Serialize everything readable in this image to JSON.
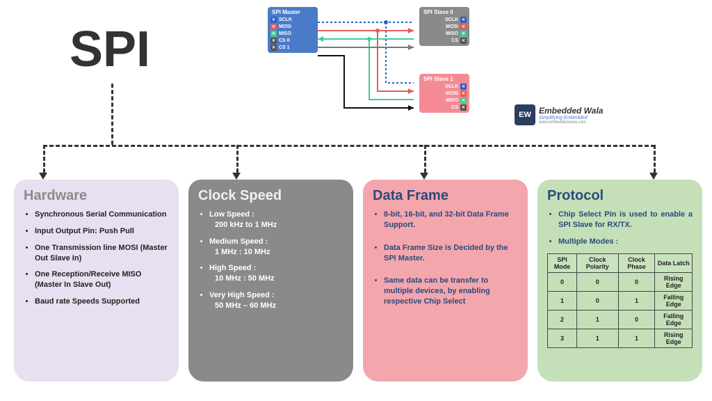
{
  "title": "SPI",
  "diagram": {
    "master": {
      "title": "SPI Master",
      "pins": [
        "SCLK",
        "MOSI",
        "MISO",
        "CS 0",
        "CS 1"
      ]
    },
    "slave0": {
      "title": "SPI Slave 0",
      "pins": [
        "SCLK",
        "MOSI",
        "MISO",
        "CS"
      ]
    },
    "slave1": {
      "title": "SPI Slave 1",
      "pins": [
        "SCLK",
        "MOSI",
        "MISO",
        "CS"
      ]
    },
    "pinColors": {
      "SCLK": "#2a5fc8",
      "MOSI": "#e85a5a",
      "MISO": "#3fcf8f",
      "CS": "#555",
      "CS 0": "#555",
      "CS 1": "#555"
    },
    "xmark": "✕"
  },
  "brand": {
    "logo": "EW",
    "line1": "Embedded Wala",
    "line2": "Simplifying Embedded",
    "line3": "www.embeddedwala.com"
  },
  "cards": {
    "hardware": {
      "title": "Hardware",
      "items": [
        "Synchronous Serial Communication",
        "Input Output Pin: Push Pull",
        "One Transmission line MOSI (Master Out Slave In)",
        "One Reception/Receive MISO (Master In Slave Out)",
        "Baud rate Speeds Supported"
      ]
    },
    "clock": {
      "title": "Clock Speed",
      "items": [
        {
          "label": "Low Speed :",
          "value": "200 kHz to 1 MHz"
        },
        {
          "label": "Medium Speed :",
          "value": "1 MHz : 10 MHz"
        },
        {
          "label": "High Speed :",
          "value": "10 MHz : 50 MHz"
        },
        {
          "label": "Very High Speed :",
          "value": "50 MHz – 60 MHz"
        }
      ]
    },
    "dataframe": {
      "title": "Data Frame",
      "items": [
        "8-bit, 16-bit, and 32-bit Data Frame Support.",
        "Data Frame Size is Decided by the SPI Master.",
        "Same data can be transfer to multiple devices, by enabling respective Chip Select"
      ]
    },
    "protocol": {
      "title": "Protocol",
      "items": [
        "Chip Select Pin is used to enable a SPI Slave for RX/TX.",
        "Multiple Modes :"
      ],
      "tableHeaders": [
        "SPI Mode",
        "Clock Polarity",
        "Clock Phase",
        "Data Latch"
      ],
      "tableRows": [
        [
          "0",
          "0",
          "0",
          "Rising Edge"
        ],
        [
          "1",
          "0",
          "1",
          "Falling Edge"
        ],
        [
          "2",
          "1",
          "0",
          "Falling Edge"
        ],
        [
          "3",
          "1",
          "1",
          "Rising Edge"
        ]
      ]
    }
  }
}
